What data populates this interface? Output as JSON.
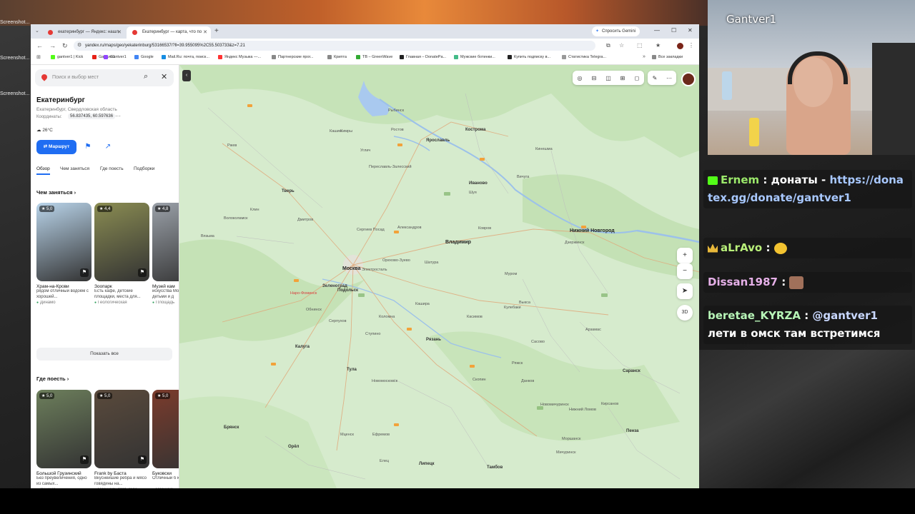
{
  "desktop": {
    "icons": [
      "Screenshot...",
      "Screenshot...",
      "Screenshot..."
    ]
  },
  "browser": {
    "tabs": [
      {
        "label": "екатеринбург — Яндекс: нашл",
        "active": false
      },
      {
        "label": "Екатеринбург — карта, что по",
        "active": true
      }
    ],
    "gemini_label": "Спросить Gemini",
    "url": "yandex.ru/maps/geo/yekaterinburg/53166537/?ll=39.955095%2C55.503733&z=7.21",
    "bookmarks": [
      "gantver1 | Kick",
      "Gantver1",
      "Google",
      "Mail.Ru: почта, поиск...",
      "Яндекс Музыка —...",
      "Партнерские прог...",
      "Криптa",
      "TB – GreenWave",
      "Главная – DonatePa...",
      "Мужские ботинки...",
      "Купить подписку в...",
      "Статистика Telegra..."
    ],
    "all_bookmarks": "Все закладки"
  },
  "panel": {
    "search_placeholder": "Поиск и выбор мест",
    "city": "Екатеринбург",
    "region": "Екатеринбург, Свердловская область",
    "coords_label": "Координаты:",
    "coords_value": "56.837435, 60.597636",
    "coords_more": "···",
    "weather": "26°C",
    "route_label": "Маршрут",
    "tabs": [
      "Обзор",
      "Чем заняться",
      "Где поесть",
      "Подборки"
    ],
    "section_todo": "Чем заняться",
    "section_eat": "Где поесть",
    "show_all": "Показать все",
    "cards_todo": [
      {
        "rating": "★ 5,0",
        "name": "Храм-на-Крови",
        "desc": "рядом отличный водоём с хорошей...",
        "tag": "Динамо",
        "color": "#b9d4ea"
      },
      {
        "rating": "★ 4,4",
        "name": "Зоопарк",
        "desc": "Есть кафе, детские площадки, места для...",
        "tag": "Геологическая",
        "color": "#8a8c52"
      },
      {
        "rating": "★ 4,8",
        "name": "Музей кам",
        "desc": "искусства Можно пос детьми и д",
        "tag": "Площадь",
        "color": "#9aa0a8"
      }
    ],
    "cards_eat": [
      {
        "rating": "★ 5,0",
        "name": "Большой Грузинский",
        "desc": "Без преувеличения, одно из самых...",
        "tag": "Динамо",
        "color": "#6d7f5c"
      },
      {
        "rating": "★ 5,0",
        "name": "Frank by Баста",
        "desc": "Вкуснейшие ребра и мясо говядины на...",
        "tag": "Площадь 1905 года",
        "color": "#5a4a3c"
      },
      {
        "rating": "★ 5,0",
        "name": "Буковски",
        "desc": "Отличный б крутая атм",
        "tag": "Площадь",
        "color": "#7b3b2c"
      }
    ]
  },
  "map": {
    "labels_big": [
      "Москва",
      "Нижний Новгород",
      "Владимир"
    ],
    "labels_mid": [
      "Ярославль",
      "Тверь",
      "Кострома",
      "Иваново",
      "Рязань",
      "Тула",
      "Калуга",
      "Орёл",
      "Тамбов",
      "Липецк",
      "Брянск",
      "Зеленоград",
      "Подольск",
      "Саранск",
      "Пенза"
    ],
    "labels_small": [
      "Рыбинск",
      "Углич",
      "Кашин",
      "Сергиев Посад",
      "Александров",
      "Ковров",
      "Муром",
      "Дзержинск",
      "Шатура",
      "Коломна",
      "Серпухов",
      "Обнинск",
      "Ступино",
      "Новомосковск",
      "Ефремов",
      "Елец",
      "Мичуринск",
      "Моршанск",
      "Касимов",
      "Кулебаки",
      "Выкса",
      "Ржев",
      "Волоколамск",
      "Клин",
      "Дмитров",
      "Орехово-Зуево",
      "Электросталь",
      "Шуя",
      "Кинешма",
      "Вичуга",
      "Переславль-Залесский",
      "Ростов",
      "Вязьма",
      "Кимры",
      "Кашира",
      "Скопин",
      "Ряжск",
      "Сасово",
      "Арзамас",
      "Кирсанов",
      "Данков",
      "Мценск",
      "Новомичуринск",
      "Нижний Ломов"
    ],
    "label_red": "Наро-Фоминск",
    "view_3d": "3D"
  },
  "stream": {
    "streamer_name": "Gantver1",
    "chat": [
      {
        "user": "Ernem",
        "sep": " : ",
        "text": "донаты - ",
        "link": "https://donatex.gg/donate/gantver1"
      },
      {
        "user": "aLrAvo",
        "sep": " : ",
        "text": ""
      },
      {
        "user": "Dissan1987",
        "sep": " : ",
        "text": ""
      },
      {
        "user": "beretae_KYRZA",
        "sep": " : ",
        "mention": "@gantver1",
        "text": " лети в омск там встретимся"
      }
    ]
  },
  "colors": {
    "accent": "#1f6df2",
    "map_green": "#cfe8c2",
    "map_water": "#a9c9ef"
  }
}
